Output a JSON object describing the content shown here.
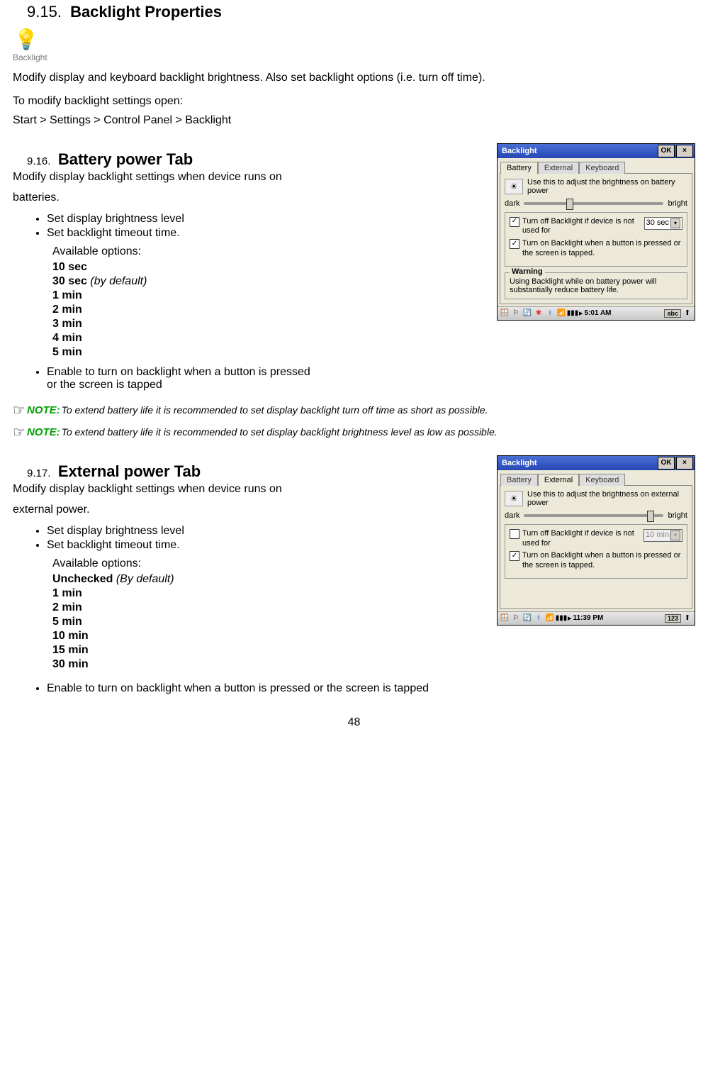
{
  "section915": {
    "number": "9.15.",
    "title": "Backlight Properties",
    "icon_caption": "Backlight",
    "intro": "Modify display and keyboard backlight brightness. Also set backlight options (i.e. turn off time).",
    "instr1": "To modify backlight settings open:",
    "instr2": "Start > Settings > Control Panel > Backlight"
  },
  "section916": {
    "number": "9.16.",
    "title": "Battery power Tab",
    "intro1": "Modify display backlight settings when device runs on",
    "intro2": "batteries.",
    "bullet1": "Set display brightness level",
    "bullet2": "Set backlight timeout time.",
    "avail": "Available options:",
    "opts": [
      {
        "val": "10 sec",
        "suffix": ""
      },
      {
        "val": "30 sec ",
        "suffix": "(by default)"
      },
      {
        "val": "1 min",
        "suffix": ""
      },
      {
        "val": "2 min",
        "suffix": ""
      },
      {
        "val": "3 min",
        "suffix": ""
      },
      {
        "val": "4 min",
        "suffix": ""
      },
      {
        "val": "5 min",
        "suffix": ""
      }
    ],
    "bullet3a": "Enable to turn on backlight when a button is pressed",
    "bullet3b": "or the screen is tapped"
  },
  "note1": {
    "label": "NOTE:",
    "text": " To extend battery life it is recommended to set display backlight turn off time as short as possible."
  },
  "note2": {
    "label": "NOTE:",
    "text": " To extend battery life it is recommended to set display backlight brightness level as low as possible."
  },
  "section917": {
    "number": "9.17.",
    "title": "External power Tab",
    "intro1": "Modify display backlight settings when device runs on",
    "intro2": "external power.",
    "bullet1": "Set display brightness level",
    "bullet2": "Set backlight timeout time.",
    "avail": "Available options:",
    "opts": [
      {
        "val": "Unchecked ",
        "suffix": "(By default)"
      },
      {
        "val": "1 min",
        "suffix": ""
      },
      {
        "val": "2 min",
        "suffix": ""
      },
      {
        "val": "5 min",
        "suffix": ""
      },
      {
        "val": "10 min",
        "suffix": ""
      },
      {
        "val": "15 min",
        "suffix": ""
      },
      {
        "val": "30 min",
        "suffix": ""
      }
    ],
    "bullet3": "Enable to turn on backlight when a button is pressed or the screen is tapped"
  },
  "screenshot_battery": {
    "title": "Backlight",
    "ok": "OK",
    "close": "×",
    "tabs": [
      "Battery",
      "External",
      "Keyboard"
    ],
    "active_tab": 0,
    "hint": "Use this to adjust the brightness on battery power",
    "dark": "dark",
    "bright": "bright",
    "slider_pos": "30%",
    "chk1_checked": true,
    "chk1": "Turn off Backlight if device is not used for",
    "select1": "30 sec",
    "chk2_checked": true,
    "chk2": "Turn on Backlight when a button is pressed or the screen is tapped.",
    "warn_title": "Warning",
    "warn": "Using Backlight while on battery power will substantially reduce battery life.",
    "time": "5:01 AM"
  },
  "screenshot_external": {
    "title": "Backlight",
    "ok": "OK",
    "close": "×",
    "tabs": [
      "Battery",
      "External",
      "Keyboard"
    ],
    "active_tab": 1,
    "hint": "Use this to adjust the brightness on external power",
    "dark": "dark",
    "bright": "bright",
    "slider_pos": "88%",
    "chk1_checked": false,
    "chk1": "Turn off Backlight if device is not used for",
    "select1": "10 min",
    "chk2_checked": true,
    "chk2": "Turn on Backlight when a button is pressed or the screen is tapped.",
    "time": "11:39 PM"
  },
  "page_number": "48"
}
